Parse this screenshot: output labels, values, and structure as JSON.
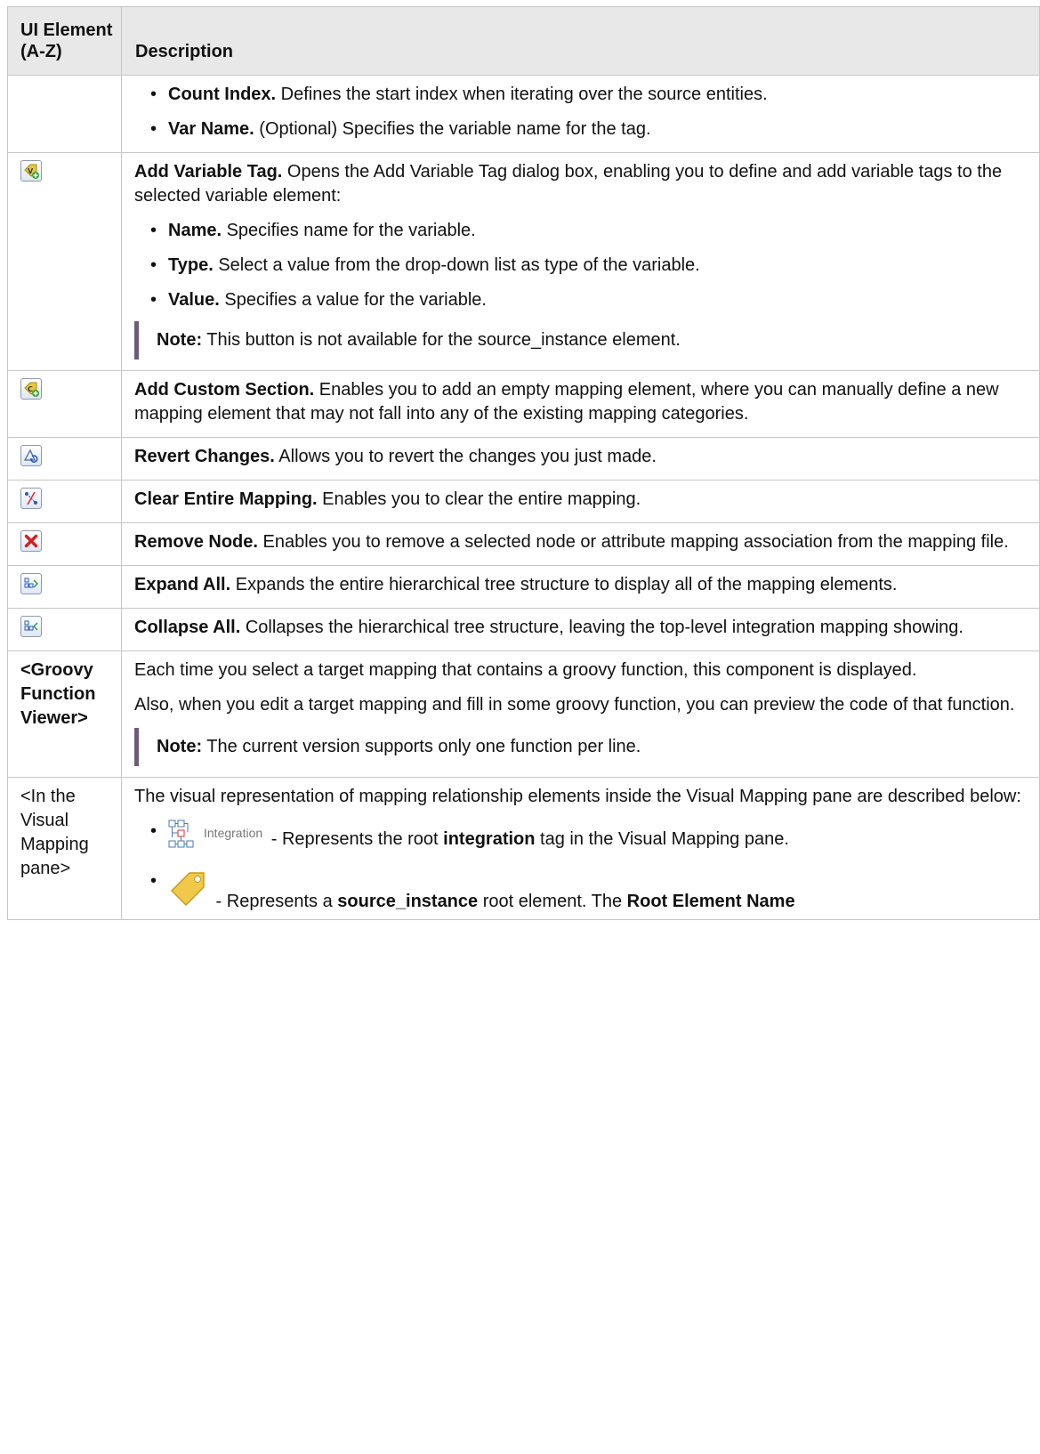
{
  "header": {
    "col1": "UI Element (A-Z)",
    "col2": "Description"
  },
  "rows": [
    {
      "bullets": [
        {
          "bold": "Count Index.",
          "text": " Defines the start index when iterating over the source entities."
        },
        {
          "bold": "Var Name.",
          "text": " (Optional) Specifies the variable name for the tag."
        }
      ]
    },
    {
      "icon": "add-variable-tag-icon",
      "title": "Add Variable Tag.",
      "text": " Opens the Add Variable Tag dialog box, enabling you to define and add variable tags to the selected variable element:",
      "bullets": [
        {
          "bold": "Name.",
          "text": " Specifies name for the variable."
        },
        {
          "bold": "Type.",
          "text": " Select a value from the drop-down list as type of the variable."
        },
        {
          "bold": "Value.",
          "text": " Specifies a value for the variable."
        }
      ],
      "note_label": "Note:",
      "note_text": " This button is not available for the source_instance element."
    },
    {
      "icon": "add-custom-section-icon",
      "title": "Add Custom Section.",
      "text": " Enables you to add an empty mapping element, where you can manually define a new mapping element that may not fall into any of the existing mapping categories."
    },
    {
      "icon": "revert-changes-icon",
      "title": "Revert Changes.",
      "text": " Allows you to revert the changes you just made."
    },
    {
      "icon": "clear-mapping-icon",
      "title": "Clear Entire Mapping.",
      "text": " Enables you to clear the entire mapping."
    },
    {
      "icon": "remove-node-icon",
      "title": "Remove Node.",
      "text": " Enables you to remove a selected node or attribute mapping association from the mapping file."
    },
    {
      "icon": "expand-all-icon",
      "title": "Expand All.",
      "text": " Expands the entire hierarchical tree structure to display all of the mapping elements."
    },
    {
      "icon": "collapse-all-icon",
      "title": "Collapse All.",
      "text": " Collapses the hierarchical tree structure, leaving the top-level integration mapping showing."
    },
    {
      "element": "<Groovy Function Viewer>",
      "para1": "Each time you select a target mapping that contains a groovy function, this component is displayed.",
      "para2": "Also, when you edit a target mapping and fill in some groovy function, you can preview the code of that function.",
      "note_label": "Note:",
      "note_text": " The current version supports only one function per line."
    },
    {
      "element": "<In the Visual Mapping pane>",
      "para1": "The visual representation of mapping relationship elements inside the Visual Mapping pane are described below:",
      "bullet1": {
        "icon_label": "Integration",
        "pre": " - Represents the root ",
        "bold": "integration",
        "post": " tag in the Visual Mapping pane."
      },
      "bullet2": {
        "pre": " - Represents a ",
        "bold": "source_instance",
        "mid": " root element. The ",
        "bold2": "Root Element Name"
      }
    }
  ],
  "colors": {
    "header_bg": "#e8e8e8",
    "border": "#c6c6c6",
    "note_bar": "#6e5a7a"
  }
}
